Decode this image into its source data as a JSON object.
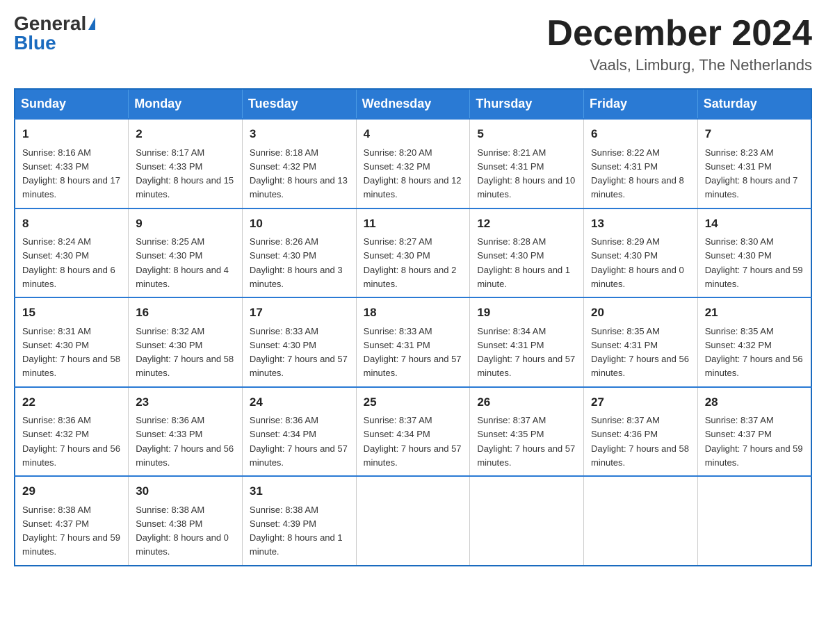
{
  "logo": {
    "general": "General",
    "blue": "Blue"
  },
  "header": {
    "month_year": "December 2024",
    "location": "Vaals, Limburg, The Netherlands"
  },
  "days_of_week": [
    "Sunday",
    "Monday",
    "Tuesday",
    "Wednesday",
    "Thursday",
    "Friday",
    "Saturday"
  ],
  "weeks": [
    [
      {
        "day": "1",
        "sunrise": "8:16 AM",
        "sunset": "4:33 PM",
        "daylight": "8 hours and 17 minutes."
      },
      {
        "day": "2",
        "sunrise": "8:17 AM",
        "sunset": "4:33 PM",
        "daylight": "8 hours and 15 minutes."
      },
      {
        "day": "3",
        "sunrise": "8:18 AM",
        "sunset": "4:32 PM",
        "daylight": "8 hours and 13 minutes."
      },
      {
        "day": "4",
        "sunrise": "8:20 AM",
        "sunset": "4:32 PM",
        "daylight": "8 hours and 12 minutes."
      },
      {
        "day": "5",
        "sunrise": "8:21 AM",
        "sunset": "4:31 PM",
        "daylight": "8 hours and 10 minutes."
      },
      {
        "day": "6",
        "sunrise": "8:22 AM",
        "sunset": "4:31 PM",
        "daylight": "8 hours and 8 minutes."
      },
      {
        "day": "7",
        "sunrise": "8:23 AM",
        "sunset": "4:31 PM",
        "daylight": "8 hours and 7 minutes."
      }
    ],
    [
      {
        "day": "8",
        "sunrise": "8:24 AM",
        "sunset": "4:30 PM",
        "daylight": "8 hours and 6 minutes."
      },
      {
        "day": "9",
        "sunrise": "8:25 AM",
        "sunset": "4:30 PM",
        "daylight": "8 hours and 4 minutes."
      },
      {
        "day": "10",
        "sunrise": "8:26 AM",
        "sunset": "4:30 PM",
        "daylight": "8 hours and 3 minutes."
      },
      {
        "day": "11",
        "sunrise": "8:27 AM",
        "sunset": "4:30 PM",
        "daylight": "8 hours and 2 minutes."
      },
      {
        "day": "12",
        "sunrise": "8:28 AM",
        "sunset": "4:30 PM",
        "daylight": "8 hours and 1 minute."
      },
      {
        "day": "13",
        "sunrise": "8:29 AM",
        "sunset": "4:30 PM",
        "daylight": "8 hours and 0 minutes."
      },
      {
        "day": "14",
        "sunrise": "8:30 AM",
        "sunset": "4:30 PM",
        "daylight": "7 hours and 59 minutes."
      }
    ],
    [
      {
        "day": "15",
        "sunrise": "8:31 AM",
        "sunset": "4:30 PM",
        "daylight": "7 hours and 58 minutes."
      },
      {
        "day": "16",
        "sunrise": "8:32 AM",
        "sunset": "4:30 PM",
        "daylight": "7 hours and 58 minutes."
      },
      {
        "day": "17",
        "sunrise": "8:33 AM",
        "sunset": "4:30 PM",
        "daylight": "7 hours and 57 minutes."
      },
      {
        "day": "18",
        "sunrise": "8:33 AM",
        "sunset": "4:31 PM",
        "daylight": "7 hours and 57 minutes."
      },
      {
        "day": "19",
        "sunrise": "8:34 AM",
        "sunset": "4:31 PM",
        "daylight": "7 hours and 57 minutes."
      },
      {
        "day": "20",
        "sunrise": "8:35 AM",
        "sunset": "4:31 PM",
        "daylight": "7 hours and 56 minutes."
      },
      {
        "day": "21",
        "sunrise": "8:35 AM",
        "sunset": "4:32 PM",
        "daylight": "7 hours and 56 minutes."
      }
    ],
    [
      {
        "day": "22",
        "sunrise": "8:36 AM",
        "sunset": "4:32 PM",
        "daylight": "7 hours and 56 minutes."
      },
      {
        "day": "23",
        "sunrise": "8:36 AM",
        "sunset": "4:33 PM",
        "daylight": "7 hours and 56 minutes."
      },
      {
        "day": "24",
        "sunrise": "8:36 AM",
        "sunset": "4:34 PM",
        "daylight": "7 hours and 57 minutes."
      },
      {
        "day": "25",
        "sunrise": "8:37 AM",
        "sunset": "4:34 PM",
        "daylight": "7 hours and 57 minutes."
      },
      {
        "day": "26",
        "sunrise": "8:37 AM",
        "sunset": "4:35 PM",
        "daylight": "7 hours and 57 minutes."
      },
      {
        "day": "27",
        "sunrise": "8:37 AM",
        "sunset": "4:36 PM",
        "daylight": "7 hours and 58 minutes."
      },
      {
        "day": "28",
        "sunrise": "8:37 AM",
        "sunset": "4:37 PM",
        "daylight": "7 hours and 59 minutes."
      }
    ],
    [
      {
        "day": "29",
        "sunrise": "8:38 AM",
        "sunset": "4:37 PM",
        "daylight": "7 hours and 59 minutes."
      },
      {
        "day": "30",
        "sunrise": "8:38 AM",
        "sunset": "4:38 PM",
        "daylight": "8 hours and 0 minutes."
      },
      {
        "day": "31",
        "sunrise": "8:38 AM",
        "sunset": "4:39 PM",
        "daylight": "8 hours and 1 minute."
      },
      null,
      null,
      null,
      null
    ]
  ]
}
